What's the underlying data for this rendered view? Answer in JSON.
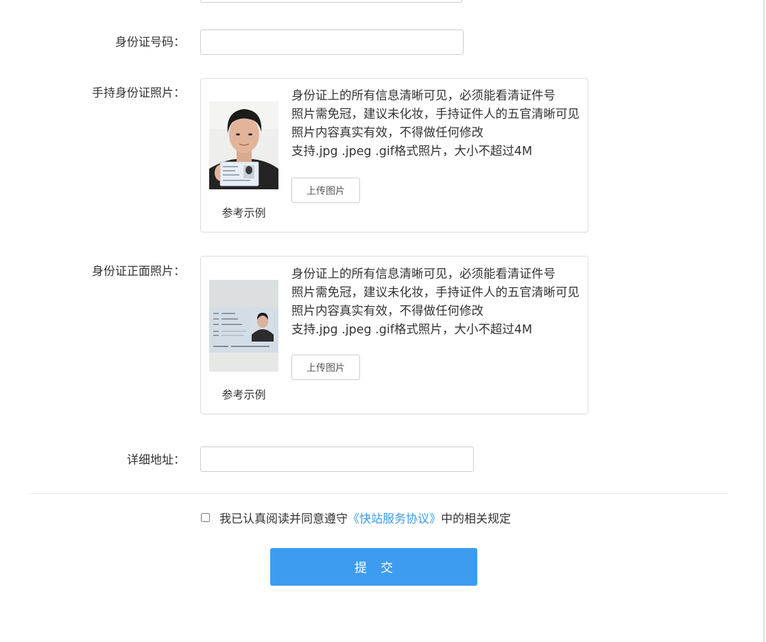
{
  "form": {
    "id_number_label": "身份证号码：",
    "id_number_value": "",
    "address_label": "详细地址：",
    "address_value": ""
  },
  "handheld": {
    "label": "手持身份证照片：",
    "sample_caption": "参考示例",
    "desc": [
      "身份证上的所有信息清晰可见，必须能看清证件号",
      "照片需免冠，建议未化妆，手持证件人的五官清晰可见",
      "照片内容真实有效，不得做任何修改",
      "支持.jpg .jpeg .gif格式照片，大小不超过4M"
    ],
    "upload_label": "上传图片"
  },
  "front": {
    "label": "身份证正面照片：",
    "sample_caption": "参考示例",
    "desc": [
      "身份证上的所有信息清晰可见，必须能看清证件号",
      "照片需免冠，建议未化妆，手持证件人的五官清晰可见",
      "照片内容真实有效，不得做任何修改",
      "支持.jpg .jpeg .gif格式照片，大小不超过4M"
    ],
    "upload_label": "上传图片"
  },
  "agreement": {
    "checked": false,
    "prefix": "我已认真阅读并同意遵守",
    "link_text": "《快站服务协议》",
    "suffix": "中的相关规定",
    "link_color": "#3d9be9"
  },
  "submit": {
    "label": "提交",
    "color": "#3e9cf0"
  }
}
